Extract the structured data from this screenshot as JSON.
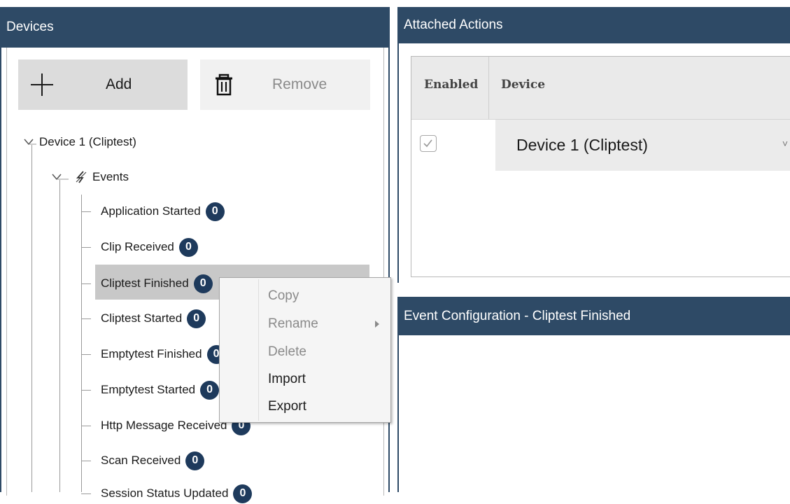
{
  "devices_panel": {
    "title": "Devices",
    "add_label": "Add",
    "remove_label": "Remove"
  },
  "tree": {
    "device": "Device 1 (Cliptest)",
    "events_label": "Events",
    "events": [
      {
        "label": "Application Started",
        "count": "0"
      },
      {
        "label": "Clip Received",
        "count": "0"
      },
      {
        "label": "Cliptest Finished",
        "count": "0"
      },
      {
        "label": "Cliptest Started",
        "count": "0"
      },
      {
        "label": "Emptytest Finished",
        "count": "0"
      },
      {
        "label": "Emptytest Started",
        "count": "0"
      },
      {
        "label": "Http Message Received",
        "count": "0"
      },
      {
        "label": "Scan Received",
        "count": "0"
      },
      {
        "label": "Session Status Updated",
        "count": "0"
      }
    ]
  },
  "context_menu": {
    "items": [
      {
        "label": "Copy",
        "enabled": false
      },
      {
        "label": "Rename",
        "enabled": false,
        "submenu": true
      },
      {
        "label": "Delete",
        "enabled": false
      },
      {
        "label": "Import",
        "enabled": true
      },
      {
        "label": "Export",
        "enabled": true
      }
    ]
  },
  "actions_panel": {
    "title": "Attached Actions",
    "columns": [
      "Enabled",
      "Device"
    ],
    "rows": [
      {
        "enabled": true,
        "device": "Device 1 (Cliptest)"
      }
    ]
  },
  "config_panel": {
    "title": "Event Configuration - Cliptest Finished"
  },
  "colors": {
    "header": "#2e4a66",
    "badge": "#1e3a5c",
    "selection": "#c8c8c8"
  }
}
